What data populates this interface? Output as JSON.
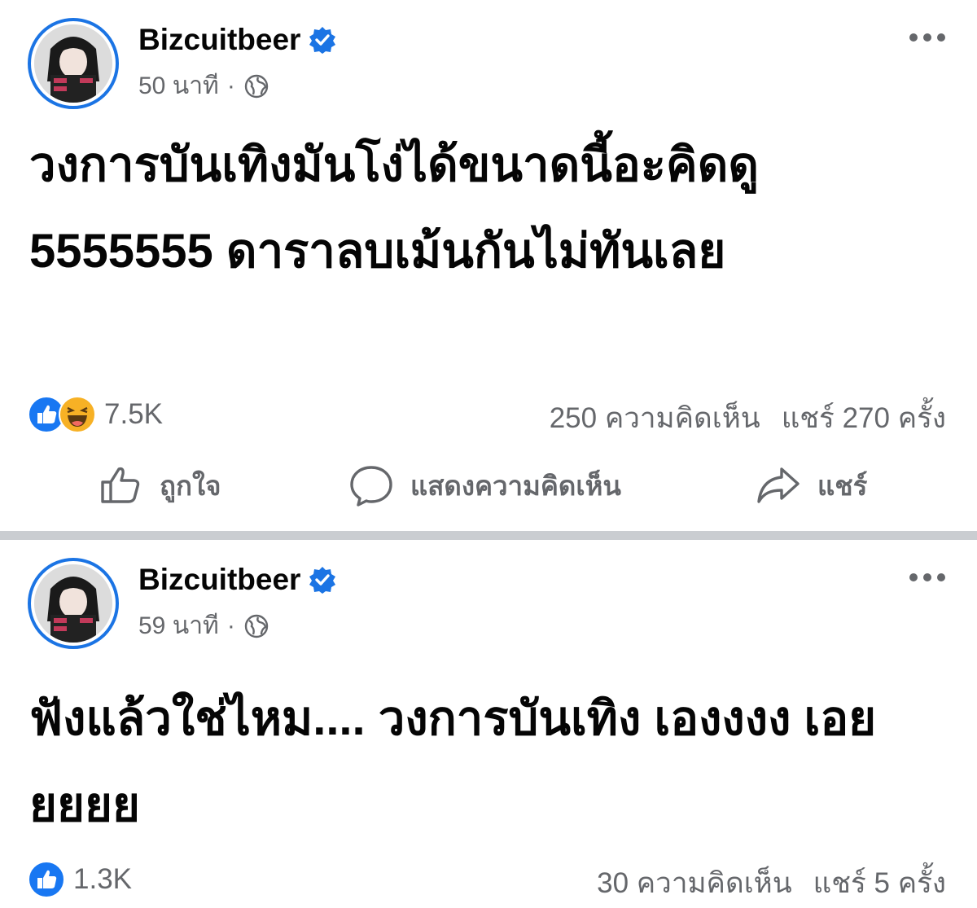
{
  "posts": [
    {
      "author": "Bizcuitbeer",
      "time": "50 นาที",
      "separator": "·",
      "text": "วงการบันเทิงมันโง่ได้ขนาดนี้อะคิดดู 5555555 ดาราลบเม้นกันไม่ทันเลย",
      "reactions": {
        "icons": [
          "like-icon",
          "haha-icon"
        ],
        "count": "7.5K"
      },
      "comments": "250 ความคิดเห็น",
      "shares": "แชร์ 270 ครั้ง",
      "actions": {
        "like": "ถูกใจ",
        "comment": "แสดงความคิดเห็น",
        "share": "แชร์"
      }
    },
    {
      "author": "Bizcuitbeer",
      "time": "59 นาที",
      "separator": "·",
      "text": "ฟังแล้วใช่ไหม.... วงการบันเทิง เองงงง เอยยยยย",
      "reactions": {
        "icons": [
          "like-icon"
        ],
        "count": "1.3K"
      },
      "comments": "30 ความคิดเห็น",
      "shares": "แชร์ 5 ครั้ง"
    }
  ],
  "colors": {
    "accent": "#1b74e4",
    "muted": "#65676b",
    "text": "#050505",
    "divider": "#cacdd1"
  }
}
